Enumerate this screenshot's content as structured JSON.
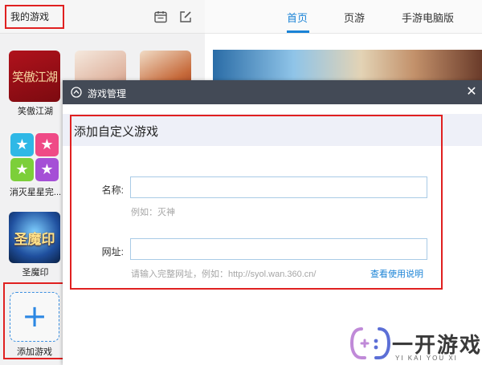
{
  "left": {
    "title": "我的游戏",
    "icons": [
      "calendar-icon",
      "edit-icon"
    ],
    "games": [
      {
        "label": "笑傲江湖",
        "thumb_text": "笑傲江湖"
      },
      {
        "label": "消灭星星完..."
      },
      {
        "label": "圣魔印",
        "thumb_text": "圣魔印"
      }
    ],
    "add": {
      "label": "添加游戏",
      "icon": "plus-icon"
    }
  },
  "tabs": [
    {
      "label": "首页",
      "active": true
    },
    {
      "label": "页游",
      "active": false
    },
    {
      "label": "手游电脑版",
      "active": false
    }
  ],
  "dialog": {
    "title": "游戏管理",
    "close_icon": "close-icon",
    "section_title": "添加自定义游戏",
    "name_label": "名称:",
    "name_value": "",
    "name_hint": "例如：灭神",
    "url_label": "网址:",
    "url_value": "",
    "url_hint": "请输入完整网址，例如：http://syol.wan.360.cn/",
    "help_link": "查看使用说明"
  },
  "watermark": {
    "text": "一开游戏",
    "sub": "YI KAI YOU XI"
  },
  "colors": {
    "accent": "#1a83d6",
    "highlight_box": "#e02020",
    "dialog_titlebar": "#434a56"
  }
}
